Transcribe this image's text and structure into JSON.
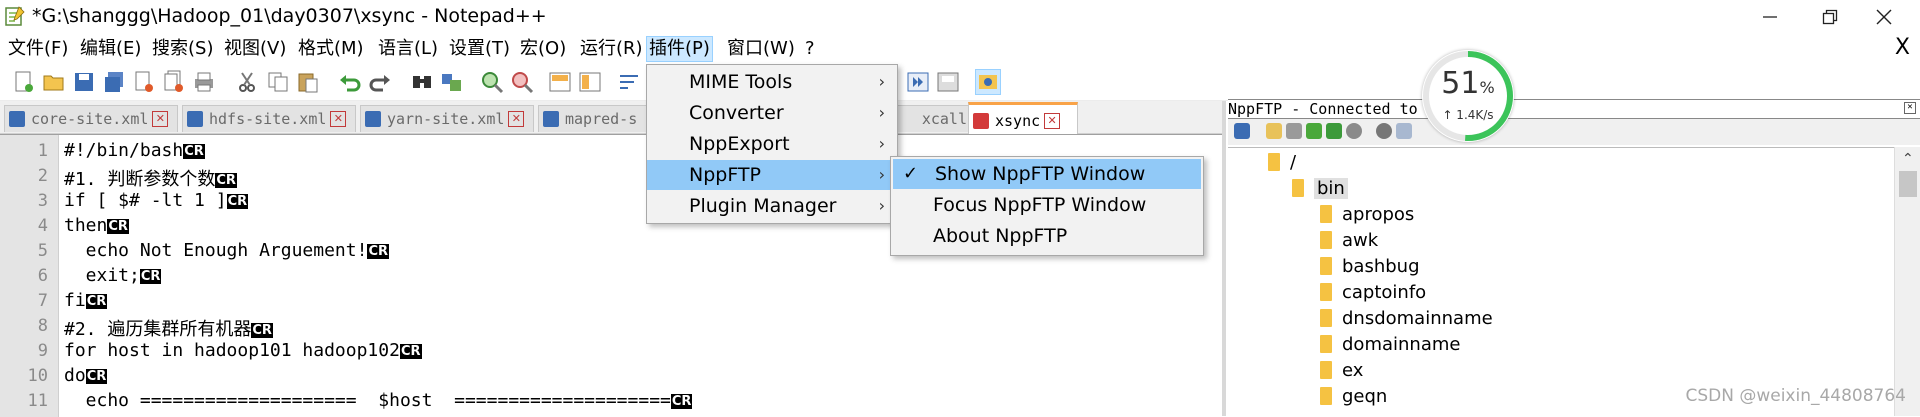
{
  "window": {
    "title": "*G:\\shanggg\\Hadoop_01\\day0307\\xsync - Notepad++",
    "minimize_icon": "minimize-icon",
    "maximize_icon": "restore-icon",
    "close_icon": "close-icon"
  },
  "menubar": {
    "items": [
      "文件(F)",
      "编辑(E)",
      "搜索(S)",
      "视图(V)",
      "格式(M)",
      "语言(L)",
      "设置(T)",
      "宏(O)",
      "运行(R)",
      "插件(P)",
      "窗口(W)",
      "?"
    ],
    "active_index": 9,
    "close_label": "X"
  },
  "tabs": [
    {
      "label": "core-site.xml",
      "modified": false
    },
    {
      "label": "hdfs-site.xml",
      "modified": false
    },
    {
      "label": "yarn-site.xml",
      "modified": false
    },
    {
      "label": "mapred-s",
      "modified": false
    },
    {
      "label": "xcall",
      "modified": false
    },
    {
      "label": "xsync",
      "modified": true,
      "active": true
    }
  ],
  "editor": {
    "lines": [
      {
        "n": "1",
        "text": "#!/bin/bash"
      },
      {
        "n": "2",
        "text": "#1. 判断参数个数"
      },
      {
        "n": "3",
        "text": "if [ $# -lt 1 ]"
      },
      {
        "n": "4",
        "text": "then"
      },
      {
        "n": "5",
        "text": "  echo Not Enough Arguement!"
      },
      {
        "n": "6",
        "text": "  exit;"
      },
      {
        "n": "7",
        "text": "fi"
      },
      {
        "n": "8",
        "text": "#2. 遍历集群所有机器"
      },
      {
        "n": "9",
        "text": "for host in hadoop101 hadoop102"
      },
      {
        "n": "10",
        "text": "do"
      },
      {
        "n": "11",
        "text": "  echo ====================  $host  ===================="
      }
    ],
    "eol_marker": "CR"
  },
  "plugins_menu": {
    "items": [
      {
        "label": "MIME Tools",
        "submenu": true
      },
      {
        "label": "Converter",
        "submenu": true
      },
      {
        "label": "NppExport",
        "submenu": true
      },
      {
        "label": "NppFTP",
        "submenu": true,
        "highlighted": true
      },
      {
        "label": "Plugin Manager",
        "submenu": true
      }
    ]
  },
  "nppftp_submenu": {
    "items": [
      {
        "label": "Show NppFTP Window",
        "checked": true,
        "highlighted": true
      },
      {
        "label": "Focus NppFTP Window",
        "checked": false
      },
      {
        "label": "About NppFTP",
        "checked": false
      }
    ]
  },
  "ftp_panel": {
    "title": "NppFTP - Connected to",
    "tree": [
      {
        "label": "/",
        "level": 0
      },
      {
        "label": "bin",
        "level": 1,
        "selected": true
      },
      {
        "label": "apropos",
        "level": 2
      },
      {
        "label": "awk",
        "level": 2
      },
      {
        "label": "bashbug",
        "level": 2
      },
      {
        "label": "captoinfo",
        "level": 2
      },
      {
        "label": "dnsdomainname",
        "level": 2
      },
      {
        "label": "domainname",
        "level": 2
      },
      {
        "label": "ex",
        "level": 2
      },
      {
        "label": "geqn",
        "level": 2
      }
    ]
  },
  "speed_widget": {
    "percent": "51",
    "percent_unit": "%",
    "rate": "↑ 1.4K/s",
    "level": 0.51,
    "color": "#3cc45a"
  },
  "watermark": "CSDN @weixin_44808764",
  "colors": {
    "menu_highlight": "#91c9f7",
    "active_tab_accent": "#f9a348",
    "gutter": "#e4e4e4"
  }
}
